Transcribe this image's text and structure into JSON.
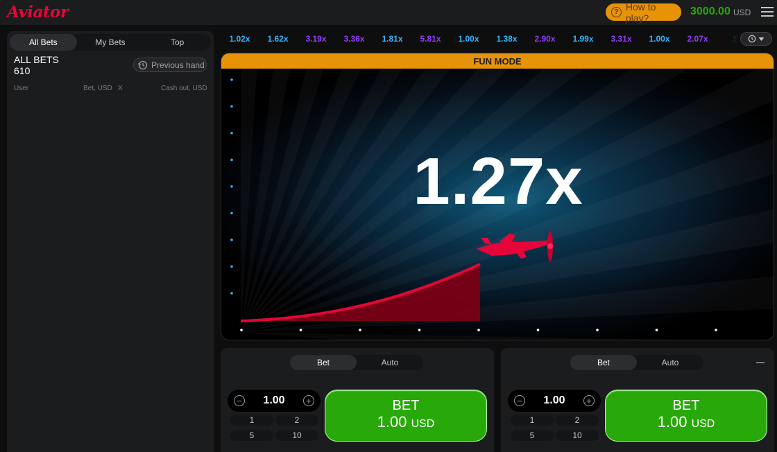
{
  "header": {
    "logo": "Aviator",
    "how_to_play": "How to play?",
    "balance": "3000.00",
    "currency": "USD"
  },
  "left_panel": {
    "tabs": [
      {
        "label": "All Bets",
        "active": true
      },
      {
        "label": "My Bets",
        "active": false
      },
      {
        "label": "Top",
        "active": false
      }
    ],
    "title": "ALL BETS",
    "count": "610",
    "previous_hand": "Previous hand",
    "columns": {
      "user": "User",
      "bet": "Bet, USD",
      "x": "X",
      "cashout": "Cash out, USD"
    }
  },
  "history": [
    {
      "value": "1.02x",
      "color": "#34b4ff"
    },
    {
      "value": "1.62x",
      "color": "#34b4ff"
    },
    {
      "value": "3.19x",
      "color": "#913ef8"
    },
    {
      "value": "3.36x",
      "color": "#913ef8"
    },
    {
      "value": "1.81x",
      "color": "#34b4ff"
    },
    {
      "value": "5.81x",
      "color": "#913ef8"
    },
    {
      "value": "1.00x",
      "color": "#34b4ff"
    },
    {
      "value": "1.38x",
      "color": "#34b4ff"
    },
    {
      "value": "2.90x",
      "color": "#913ef8"
    },
    {
      "value": "1.99x",
      "color": "#34b4ff"
    },
    {
      "value": "3.31x",
      "color": "#913ef8"
    },
    {
      "value": "1.00x",
      "color": "#34b4ff"
    },
    {
      "value": "2.07x",
      "color": "#913ef8"
    },
    {
      "value": "1.",
      "color": "#34b4ff"
    }
  ],
  "game": {
    "mode_label": "FUN MODE",
    "multiplier": "1.27x",
    "accent": "#e50539"
  },
  "bet_panels": [
    {
      "tabs": [
        {
          "label": "Bet",
          "active": true
        },
        {
          "label": "Auto",
          "active": false
        }
      ],
      "amount": "1.00",
      "quick": [
        "1",
        "2",
        "5",
        "10"
      ],
      "button_label": "BET",
      "button_amount": "1.00",
      "button_currency": "USD",
      "removable": false
    },
    {
      "tabs": [
        {
          "label": "Bet",
          "active": true
        },
        {
          "label": "Auto",
          "active": false
        }
      ],
      "amount": "1.00",
      "quick": [
        "1",
        "2",
        "5",
        "10"
      ],
      "button_label": "BET",
      "button_amount": "1.00",
      "button_currency": "USD",
      "removable": true
    }
  ]
}
